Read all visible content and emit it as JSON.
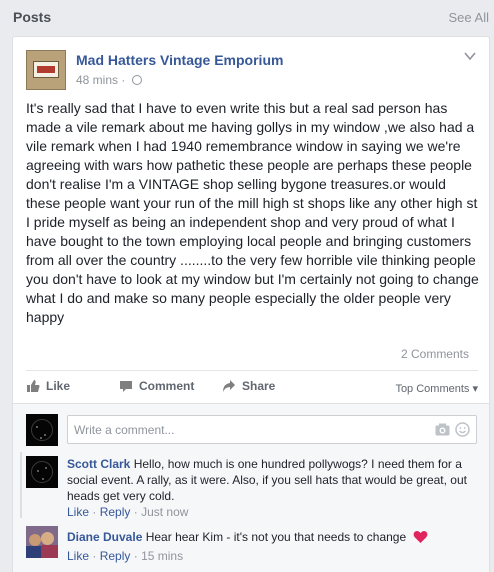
{
  "header": {
    "title": "Posts",
    "see_all": "See All"
  },
  "post": {
    "page_name": "Mad Hatters Vintage Emporium",
    "time": "48 mins",
    "separator": "·",
    "text": "It's really sad that I have to even write this but a real sad person has made a vile remark about me having gollys in my window ,we also had a vile remark when I had 1940 remembrance window in saying we we're agreeing with wars how pathetic these people are perhaps these people don't realise I'm a VINTAGE shop selling bygone treasures.or would these people want your run of the mill high st shops like any other high st I pride myself as being an independent shop and very proud of what I have bought to the town employing local people and bringing customers from all over the country ........to the very few horrible vile thinking people you don't have to look at my window but I'm certainly not going to change what I do and make so many people especially the older people very happy",
    "comments_count": "2 Comments"
  },
  "actions": {
    "like": "Like",
    "comment": "Comment",
    "share": "Share",
    "top_comments": "Top Comments ▾"
  },
  "comment_box": {
    "placeholder": "Write a comment...",
    "value": ""
  },
  "comments": [
    {
      "name": "Scott Clark",
      "text": "Hello, how much is one hundred pollywogs? I need them for a social event. A rally, as it were. Also, if you sell hats that would be great, out heads get very cold.",
      "like": "Like",
      "reply": "Reply",
      "sep": "·",
      "time": "Just now"
    },
    {
      "name": "Diane Duvale",
      "text": "Hear hear Kim - it's not you that needs to change",
      "like": "Like",
      "reply": "Reply",
      "sep": "·",
      "time": "15 mins"
    }
  ],
  "colors": {
    "link": "#365899",
    "muted": "#90949c",
    "heart": "#e0245e",
    "background": "#e9ebee"
  },
  "icons": [
    "chevron-down-icon",
    "globe-icon",
    "like-icon",
    "comment-icon",
    "share-icon",
    "camera-icon",
    "smiley-icon",
    "heart-icon"
  ]
}
